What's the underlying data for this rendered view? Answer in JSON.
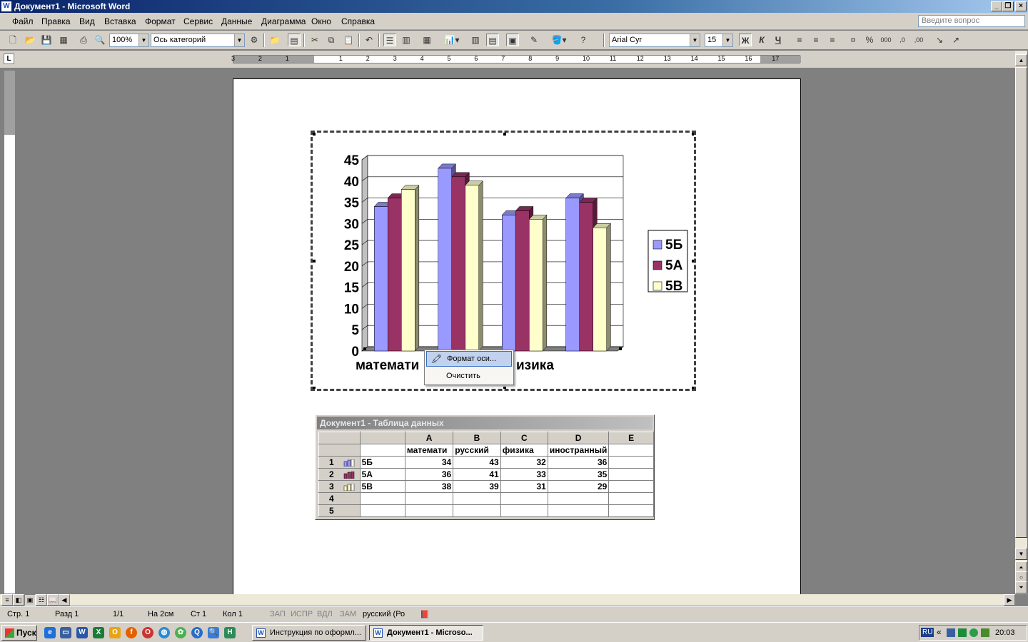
{
  "window": {
    "title": "Документ1 - Microsoft Word"
  },
  "menu": {
    "items": [
      "Файл",
      "Правка",
      "Вид",
      "Вставка",
      "Формат",
      "Сервис",
      "Данные",
      "Диаграмма",
      "Окно",
      "Справка"
    ],
    "ask_placeholder": "Введите вопрос"
  },
  "toolbar": {
    "zoom": "100%",
    "chart_object": "Ось категорий",
    "font": "Arial Cyr",
    "font_size": "15",
    "bold_label": "Ж",
    "italic_label": "К",
    "underline_label": "Ч"
  },
  "ruler": {
    "h_ticks": [
      "3",
      "2",
      "1",
      "1",
      "2",
      "3",
      "4",
      "5",
      "6",
      "7",
      "8",
      "9",
      "10",
      "11",
      "12",
      "13",
      "14",
      "15",
      "16",
      "17"
    ]
  },
  "chart_data": {
    "type": "bar",
    "categories": [
      "математика",
      "русский",
      "физика",
      "иностранный"
    ],
    "series": [
      {
        "name": "5Б",
        "values": [
          34,
          43,
          32,
          36
        ],
        "color": "#9999ff"
      },
      {
        "name": "5А",
        "values": [
          36,
          41,
          33,
          35
        ],
        "color": "#993366"
      },
      {
        "name": "5В",
        "values": [
          38,
          39,
          31,
          29
        ],
        "color": "#ffffcc"
      }
    ],
    "ylim": [
      0,
      45
    ],
    "yticks": [
      "0",
      "5",
      "10",
      "15",
      "20",
      "25",
      "30",
      "35",
      "40",
      "45"
    ],
    "visible_category_labels": {
      "left": "математи",
      "right": "изика"
    },
    "legend_position": "right",
    "grid": true
  },
  "context_menu": {
    "items": [
      "Формат оси...",
      "Очистить"
    ]
  },
  "datasheet": {
    "title": "Документ1 - Таблица данных",
    "columns": [
      "A",
      "B",
      "C",
      "D",
      "E"
    ],
    "header_row": [
      "математи",
      "русский",
      "физика",
      "иностранный",
      ""
    ],
    "rows": [
      {
        "num": "1",
        "label": "5Б",
        "values": [
          "34",
          "43",
          "32",
          "36",
          ""
        ]
      },
      {
        "num": "2",
        "label": "5А",
        "values": [
          "36",
          "41",
          "33",
          "35",
          ""
        ]
      },
      {
        "num": "3",
        "label": "5В",
        "values": [
          "38",
          "39",
          "31",
          "29",
          ""
        ]
      },
      {
        "num": "4",
        "label": "",
        "values": [
          "",
          "",
          "",
          "",
          ""
        ]
      },
      {
        "num": "5",
        "label": "",
        "values": [
          "",
          "",
          "",
          "",
          ""
        ]
      }
    ]
  },
  "status": {
    "page": "Стр. 1",
    "section": "Разд 1",
    "pages": "1/1",
    "at": "На 2см",
    "line": "Ст 1",
    "col": "Кол 1",
    "rec": "ЗАП",
    "trk": "ИСПР",
    "ext": "ВДЛ",
    "ovr": "ЗАМ",
    "lang": "русский (Ро"
  },
  "taskbar": {
    "start": "Пуск",
    "tasks": [
      "Инструкция по оформл...",
      "Документ1 - Microso..."
    ],
    "lang": "RU",
    "clock": "20:03"
  }
}
